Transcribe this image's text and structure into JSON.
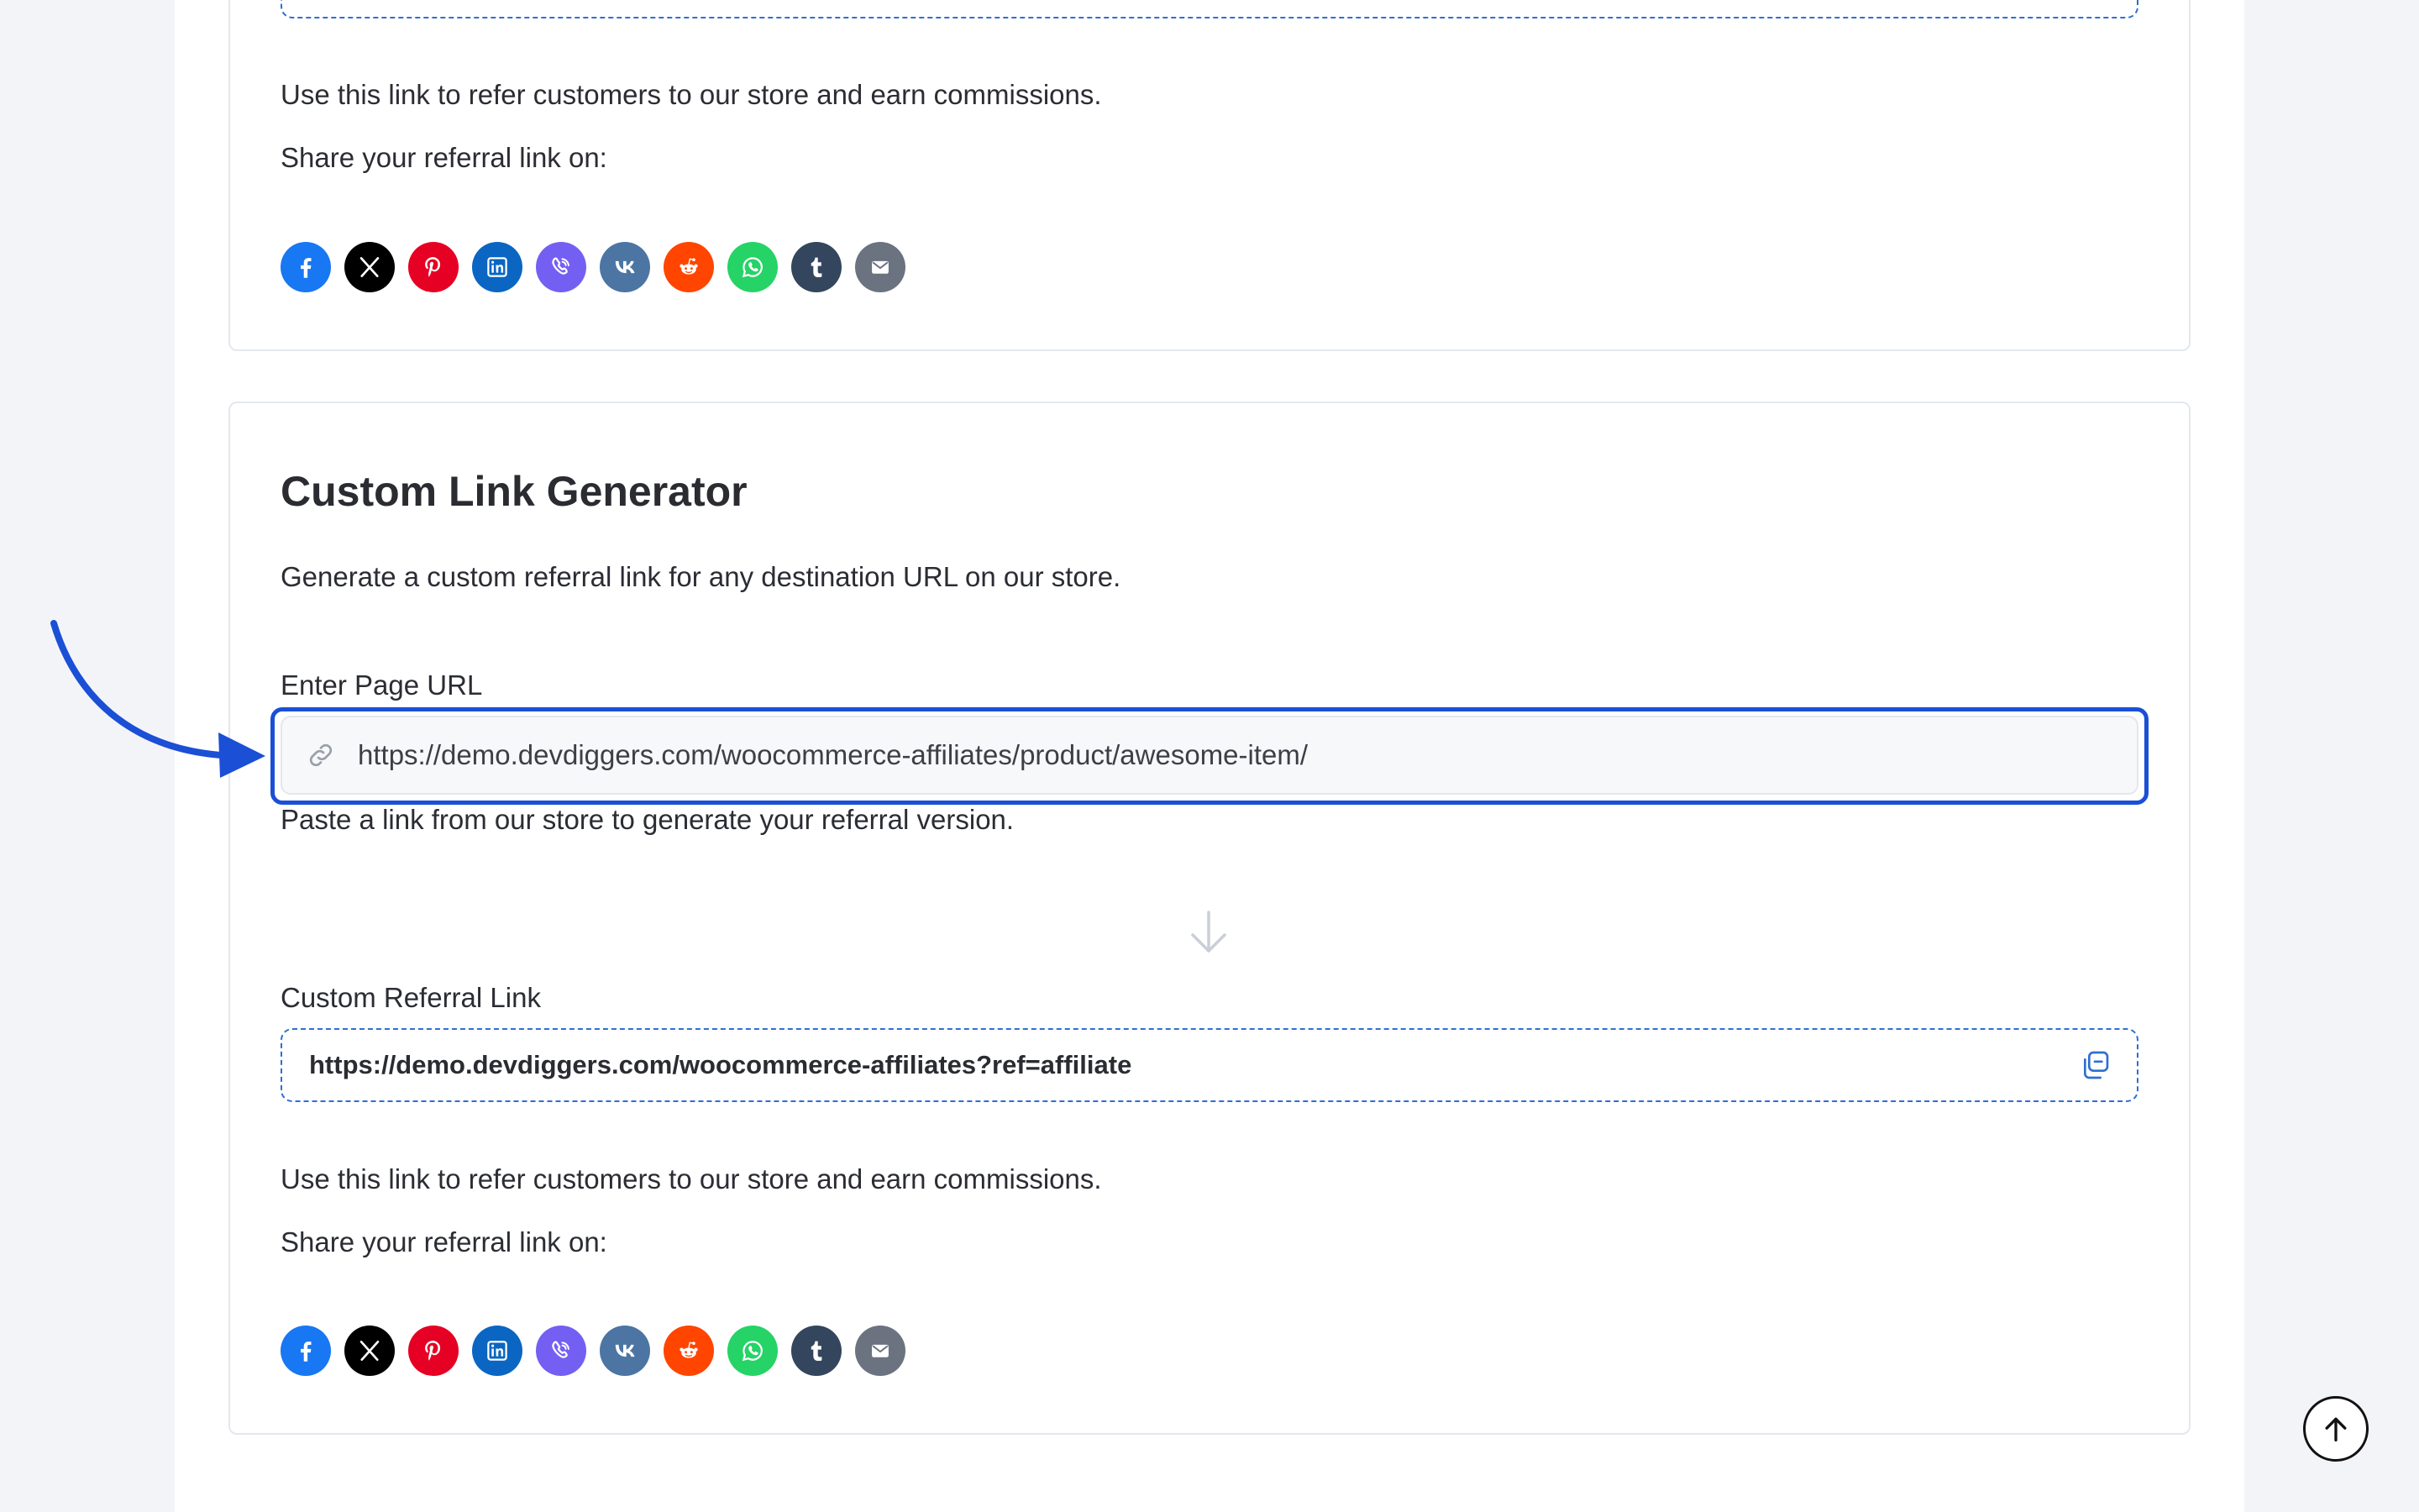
{
  "top_card": {
    "description": "Use this link to refer customers to our store and earn commissions.",
    "share_label": "Share your referral link on:"
  },
  "custom_link": {
    "title": "Custom Link Generator",
    "subtitle": "Generate a custom referral link for any destination URL on our store.",
    "input_label": "Enter Page URL",
    "input_value": "https://demo.devdiggers.com/woocommerce-affiliates/product/awesome-item/",
    "input_help": "Paste a link from our store to generate your referral version.",
    "output_label": "Custom Referral Link",
    "output_value": "https://demo.devdiggers.com/woocommerce-affiliates?ref=affiliate",
    "description": "Use this link to refer customers to our store and earn commissions.",
    "share_label": "Share your referral link on:"
  },
  "share_networks": [
    {
      "name": "facebook",
      "color": "#1877f2"
    },
    {
      "name": "x",
      "color": "#000000"
    },
    {
      "name": "pinterest",
      "color": "#e60023"
    },
    {
      "name": "linkedin",
      "color": "#0a66c2"
    },
    {
      "name": "viber",
      "color": "#7360f2"
    },
    {
      "name": "vk",
      "color": "#4c75a3"
    },
    {
      "name": "reddit",
      "color": "#ff4500"
    },
    {
      "name": "whatsapp",
      "color": "#25d366"
    },
    {
      "name": "tumblr",
      "color": "#34465d"
    },
    {
      "name": "email",
      "color": "#6b7280"
    }
  ],
  "colors": {
    "accent": "#1a4fd6",
    "dashed_border": "#2f6fd1"
  }
}
